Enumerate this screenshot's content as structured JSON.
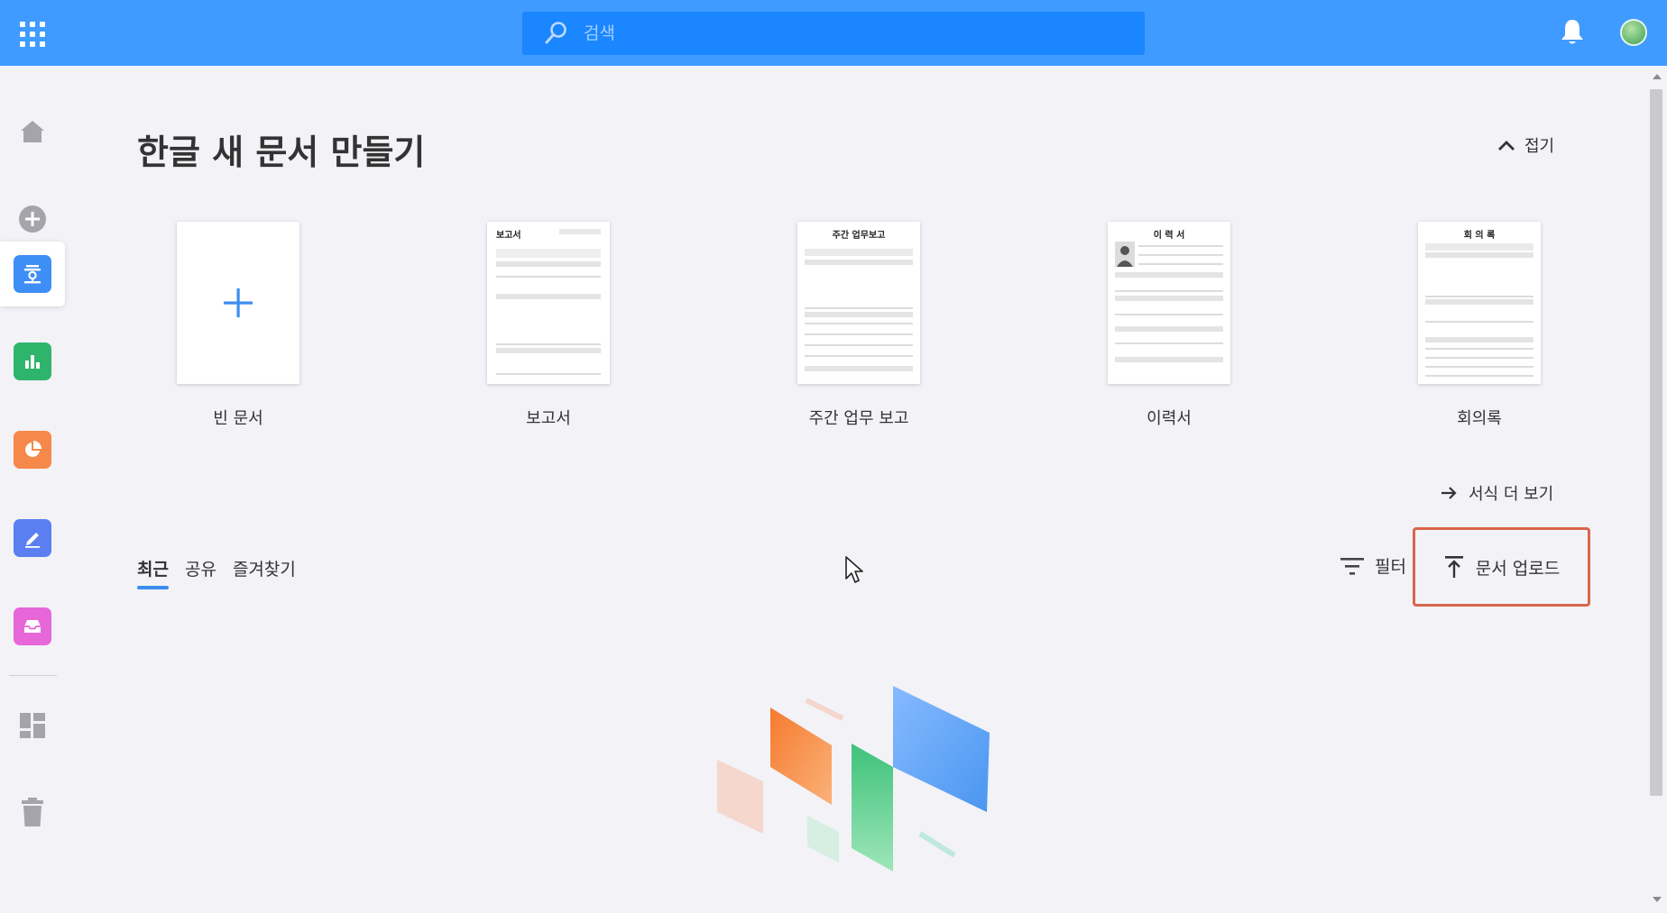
{
  "header": {
    "search_placeholder": "검색"
  },
  "sidebar": {
    "items": [
      {
        "name": "home",
        "icon": "home-icon"
      },
      {
        "name": "new",
        "icon": "plus-circle-icon"
      },
      {
        "name": "hangul",
        "icon": "hangul-doc-icon",
        "glyph": "ㅎ",
        "color": "#3d8ef5",
        "active": true
      },
      {
        "name": "hancell",
        "icon": "bar-chart-icon",
        "color": "#2fb56b"
      },
      {
        "name": "hanshow",
        "icon": "pie-chart-icon",
        "color": "#f5884a"
      },
      {
        "name": "hanword",
        "icon": "pen-icon",
        "color": "#5b7ff0"
      },
      {
        "name": "inbox",
        "icon": "inbox-icon",
        "color": "#e766d8"
      },
      {
        "name": "dashboard",
        "icon": "dashboard-icon"
      },
      {
        "name": "trash",
        "icon": "trash-icon"
      }
    ]
  },
  "main": {
    "title": "한글 새 문서 만들기",
    "collapse_label": "접기",
    "templates": [
      {
        "label": "빈 문서",
        "thumb_title": ""
      },
      {
        "label": "보고서",
        "thumb_title": "보고서"
      },
      {
        "label": "주간 업무 보고",
        "thumb_title": "주간 업무보고"
      },
      {
        "label": "이력서",
        "thumb_title": "이 력 서"
      },
      {
        "label": "회의록",
        "thumb_title": "회 의 록"
      }
    ],
    "more_templates_label": "서식 더 보기",
    "tabs": [
      {
        "label": "최근",
        "active": true
      },
      {
        "label": "공유",
        "active": false
      },
      {
        "label": "즐겨찾기",
        "active": false
      }
    ],
    "filter_label": "필터",
    "upload_label": "문서 업로드"
  },
  "colors": {
    "topbar": "#3f9bff",
    "search": "#1a86ff",
    "accent": "#3b8ef0",
    "highlight": "#d9654c",
    "background": "#f2f2f7"
  }
}
